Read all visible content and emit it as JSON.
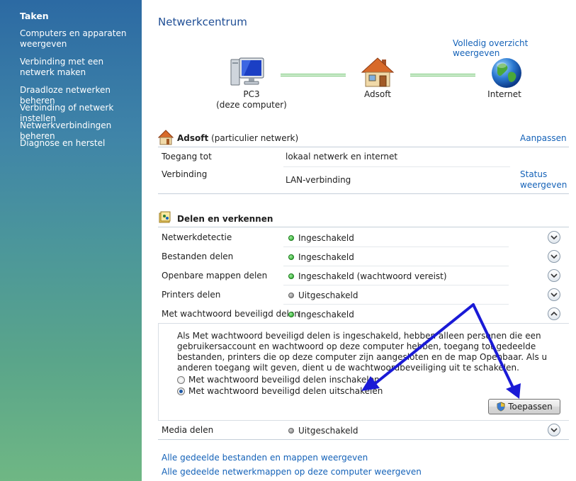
{
  "sidebar": {
    "title": "Taken",
    "links": [
      "Computers en apparaten weergeven",
      "Verbinding met een netwerk maken",
      "Draadloze netwerken beheren",
      "Verbinding of netwerk instellen",
      "Netwerkverbindingen beheren",
      "Diagnose en herstel"
    ]
  },
  "header": {
    "title": "Netwerkcentrum",
    "full_map_link": "Volledig overzicht weergeven"
  },
  "network_map": {
    "nodes": [
      {
        "name": "PC3",
        "sub": "(deze computer)",
        "icon": "computer-icon"
      },
      {
        "name": "Adsoft",
        "sub": "",
        "icon": "house-icon"
      },
      {
        "name": "Internet",
        "sub": "",
        "icon": "globe-icon"
      }
    ]
  },
  "network": {
    "name": "Adsoft",
    "type": "(particulier netwerk)",
    "customize_link": "Aanpassen",
    "access_label": "Toegang tot",
    "access_value": "lokaal netwerk en internet",
    "connection_label": "Verbinding",
    "connection_value": "LAN-verbinding",
    "status_link_line1": "Status",
    "status_link_line2": "weergeven"
  },
  "sharing": {
    "title": "Delen en verkennen",
    "rows": [
      {
        "label": "Netwerkdetectie",
        "status": "Ingeschakeld",
        "on": true
      },
      {
        "label": "Bestanden delen",
        "status": "Ingeschakeld",
        "on": true
      },
      {
        "label": "Openbare mappen delen",
        "status": "Ingeschakeld (wachtwoord vereist)",
        "on": true
      },
      {
        "label": "Printers delen",
        "status": "Uitgeschakeld",
        "on": false
      },
      {
        "label": "Met wachtwoord beveiligd delen",
        "status": "Ingeschakeld",
        "on": true
      }
    ],
    "expanded": {
      "description": "Als Met wachtwoord beveiligd delen is ingeschakeld, hebben alleen personen die een gebruikersaccount en wachtwoord op deze computer hebben, toegang tot gedeelde bestanden, printers die op deze computer zijn aangesloten en de map Openbaar. Als u anderen toegang wilt geven, dient u de wachtwoordbeveiliging uit te schakelen.",
      "option_on": "Met wachtwoord beveiligd delen inschakelen",
      "option_off": "Met wachtwoord beveiligd delen uitschakelen",
      "selected": "off",
      "apply_button": "Toepassen"
    },
    "media_row": {
      "label": "Media delen",
      "status": "Uitgeschakeld",
      "on": false
    }
  },
  "footer_links": [
    "Alle gedeelde bestanden en mappen weergeven",
    "Alle gedeelde netwerkmappen op deze computer weergeven"
  ],
  "annotation_color": "#1a1ad6"
}
